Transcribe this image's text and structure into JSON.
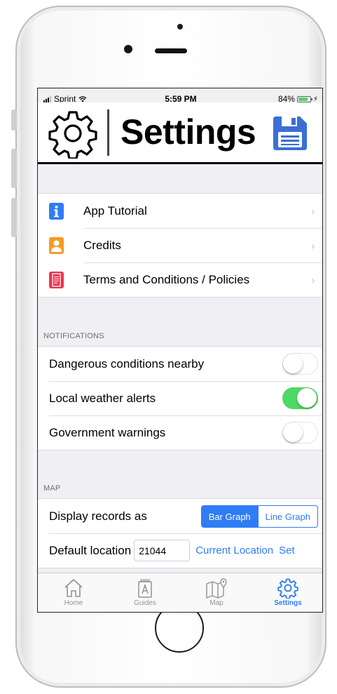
{
  "status_bar": {
    "carrier": "Sprint",
    "time": "5:59 PM",
    "battery": "84%",
    "battery_level": 0.84
  },
  "header": {
    "title": "Settings"
  },
  "menu": [
    {
      "label": "App Tutorial",
      "icon": "info-icon",
      "color": "#2f7cf6"
    },
    {
      "label": "Credits",
      "icon": "person-icon",
      "color": "#f59a23"
    },
    {
      "label": "Terms and Conditions / Policies",
      "icon": "document-icon",
      "color": "#e8384f"
    }
  ],
  "notifications": {
    "header": "NOTIFICATIONS",
    "items": [
      {
        "label": "Dangerous conditions nearby",
        "on": false
      },
      {
        "label": "Local weather alerts",
        "on": true
      },
      {
        "label": "Government warnings",
        "on": false
      }
    ]
  },
  "map": {
    "header": "MAP",
    "display_label": "Display records as",
    "options": [
      "Bar Graph",
      "Line Graph"
    ],
    "selected": "Bar Graph",
    "default_location_label": "Default location",
    "zip": "21044",
    "current_location": "Current Location",
    "set": "Set"
  },
  "tabs": [
    {
      "label": "Home",
      "icon": "home-icon",
      "active": false
    },
    {
      "label": "Guides",
      "icon": "guides-icon",
      "active": false
    },
    {
      "label": "Map",
      "icon": "map-icon",
      "active": false
    },
    {
      "label": "Settings",
      "icon": "gear-icon",
      "active": true
    }
  ],
  "colors": {
    "accent": "#2f7cf6",
    "toggle_on": "#4cd964",
    "save_icon": "#3b6fd4"
  }
}
